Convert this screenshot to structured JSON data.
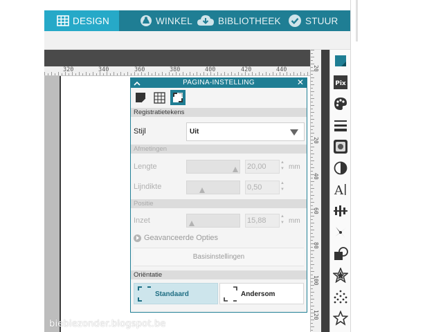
{
  "nav": {
    "tabs": [
      {
        "label": "DESIGN",
        "icon": "grid-icon",
        "active": true
      },
      {
        "label": "WINKEL",
        "icon": "silhouette-icon",
        "active": false
      },
      {
        "label": "BIBLIOTHEEK",
        "icon": "cloud-download-icon",
        "active": false
      },
      {
        "label": "STUUR",
        "icon": "checkmark-icon",
        "active": false
      }
    ]
  },
  "ruler": {
    "horizontal": [
      "320",
      "340",
      "360",
      "380",
      "400",
      "420",
      "440"
    ],
    "vertical": [
      "20",
      "40",
      "60",
      "80",
      "100",
      "120"
    ]
  },
  "panel": {
    "title": "PAGINA-INSTELLING",
    "tabs": [
      {
        "name": "page-icon"
      },
      {
        "name": "grid-icon"
      },
      {
        "name": "registration-marks-icon",
        "selected": true
      }
    ],
    "registration_section": "Registratietekens",
    "style_label": "Stijl",
    "style_value": "Uit",
    "dimensions_section": "Afmetingen",
    "length_label": "Lengte",
    "length_value": "20,00",
    "length_unit": "mm",
    "thickness_label": "Lijndikte",
    "thickness_value": "0,50",
    "position_section": "Positie",
    "inset_label": "Inzet",
    "inset_value": "15,88",
    "inset_unit": "mm",
    "advanced_label": "Geavanceerde Opties",
    "basic_settings_label": "Basisinstellingen",
    "orientation_section": "Oriëntatie",
    "orientation_standard": "Standaard",
    "orientation_reverse": "Andersom",
    "orientation_selected": "Standaard"
  },
  "tools": [
    "page-settings-icon",
    "pixscan-icon",
    "palette-icon",
    "line-style-icon",
    "fill-pattern-icon",
    "contrast-icon",
    "text-icon",
    "align-icon",
    "replicate-icon",
    "modify-icon",
    "star-icon",
    "sparkle-icon",
    "star-outline-icon"
  ],
  "watermark": "biebiezonder.blogspot.be",
  "colors": {
    "nav": "#1f7e94",
    "nav_active": "#26a9c8",
    "panel_header": "#1f7e94",
    "selected": "#cde5ec"
  }
}
